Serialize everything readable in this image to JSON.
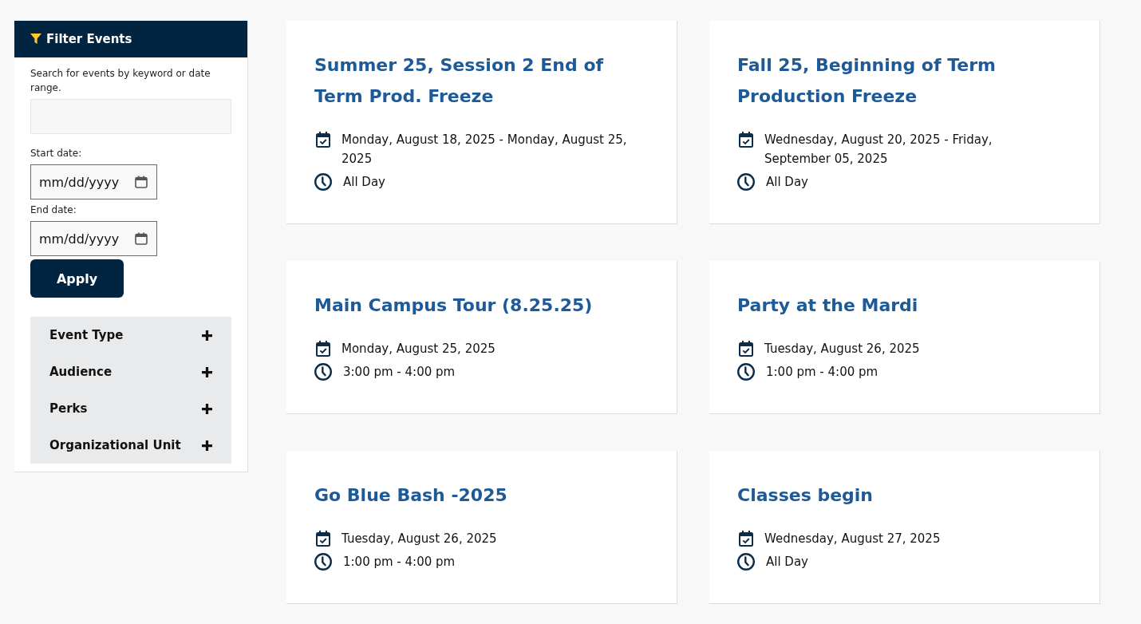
{
  "sidebar": {
    "header": {
      "title": "Filter Events"
    },
    "description": "Search for events by keyword or date range.",
    "date_fields": [
      {
        "label": "Start date:",
        "placeholder": "mm/dd/yyyy"
      },
      {
        "label": "End date:",
        "placeholder": "mm/dd/yyyy"
      }
    ],
    "apply_button": "Apply",
    "accordion": [
      {
        "label": "Event Type",
        "expanded": false
      },
      {
        "label": "Audience",
        "expanded": false
      },
      {
        "label": "Perks",
        "expanded": false
      },
      {
        "label": "Organizational Unit",
        "expanded": false
      }
    ]
  },
  "events": [
    {
      "title": "Summer 25, Session 2 End of Term Prod. Freeze",
      "date": "Monday, August 18, 2025 - Monday, August 25, 2025",
      "time": "All Day"
    },
    {
      "title": "Fall 25, Beginning of Term Production Freeze",
      "date": "Wednesday, August 20, 2025 - Friday, September 05, 2025",
      "time": "All Day"
    },
    {
      "title": "Main Campus Tour (8.25.25)",
      "date": "Monday, August 25, 2025",
      "time": "3:00 pm - 4:00 pm"
    },
    {
      "title": "Party at the Mardi",
      "date": "Tuesday, August 26, 2025",
      "time": "1:00 pm - 4:00 pm"
    },
    {
      "title": "Go Blue Bash -2025",
      "date": "Tuesday, August 26, 2025",
      "time": "1:00 pm - 4:00 pm"
    },
    {
      "title": "Classes begin",
      "date": "Wednesday, August 27, 2025",
      "time": "All Day"
    }
  ]
}
